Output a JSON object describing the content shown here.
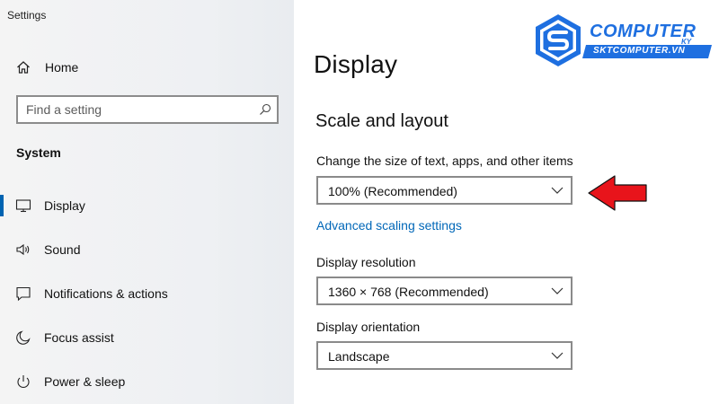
{
  "window": {
    "title": "Settings"
  },
  "sidebar": {
    "home_label": "Home",
    "search_placeholder": "Find a setting",
    "section_label": "System",
    "items": [
      {
        "label": "Display",
        "icon": "monitor-icon",
        "selected": true
      },
      {
        "label": "Sound",
        "icon": "speaker-icon",
        "selected": false
      },
      {
        "label": "Notifications & actions",
        "icon": "notification-icon",
        "selected": false
      },
      {
        "label": "Focus assist",
        "icon": "moon-icon",
        "selected": false
      },
      {
        "label": "Power & sleep",
        "icon": "power-icon",
        "selected": false
      }
    ]
  },
  "main": {
    "page_title": "Display",
    "section_title": "Scale and layout",
    "scale": {
      "label": "Change the size of text, apps, and other items",
      "value": "100% (Recommended)"
    },
    "advanced_link": "Advanced scaling settings",
    "resolution": {
      "label": "Display resolution",
      "value": "1360 × 768 (Recommended)"
    },
    "orientation": {
      "label": "Display orientation",
      "value": "Landscape"
    }
  },
  "annotation": {
    "arrow_color": "#e8141b",
    "points_to": "scale-dropdown"
  },
  "logo": {
    "line1": "COMPUTER",
    "line1_suffix": "KY",
    "line2": "SKTCOMPUTER.VN",
    "color": "#1e6fe0"
  },
  "colors": {
    "accent": "#0063b1",
    "link": "#0067b8"
  }
}
